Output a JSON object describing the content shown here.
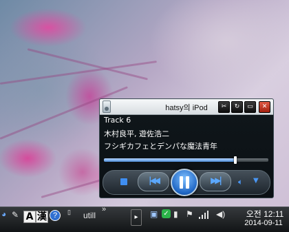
{
  "player": {
    "title": "hatsy의 iPod",
    "track": "Track 6",
    "artist": "木村良平, 遊佐浩二",
    "song": "フシギカフェとデンパな魔法青年",
    "progress": 0.8,
    "titlebar_buttons": [
      "settings-icon",
      "refresh-icon",
      "minimize-icon",
      "close-icon"
    ]
  },
  "taskbar": {
    "ime_a": "A",
    "ime_han": "漢",
    "toolbar_label": "utill",
    "expand_chevron": "»",
    "clock_time": "오전 12:11",
    "clock_date": "2014-09-11"
  }
}
